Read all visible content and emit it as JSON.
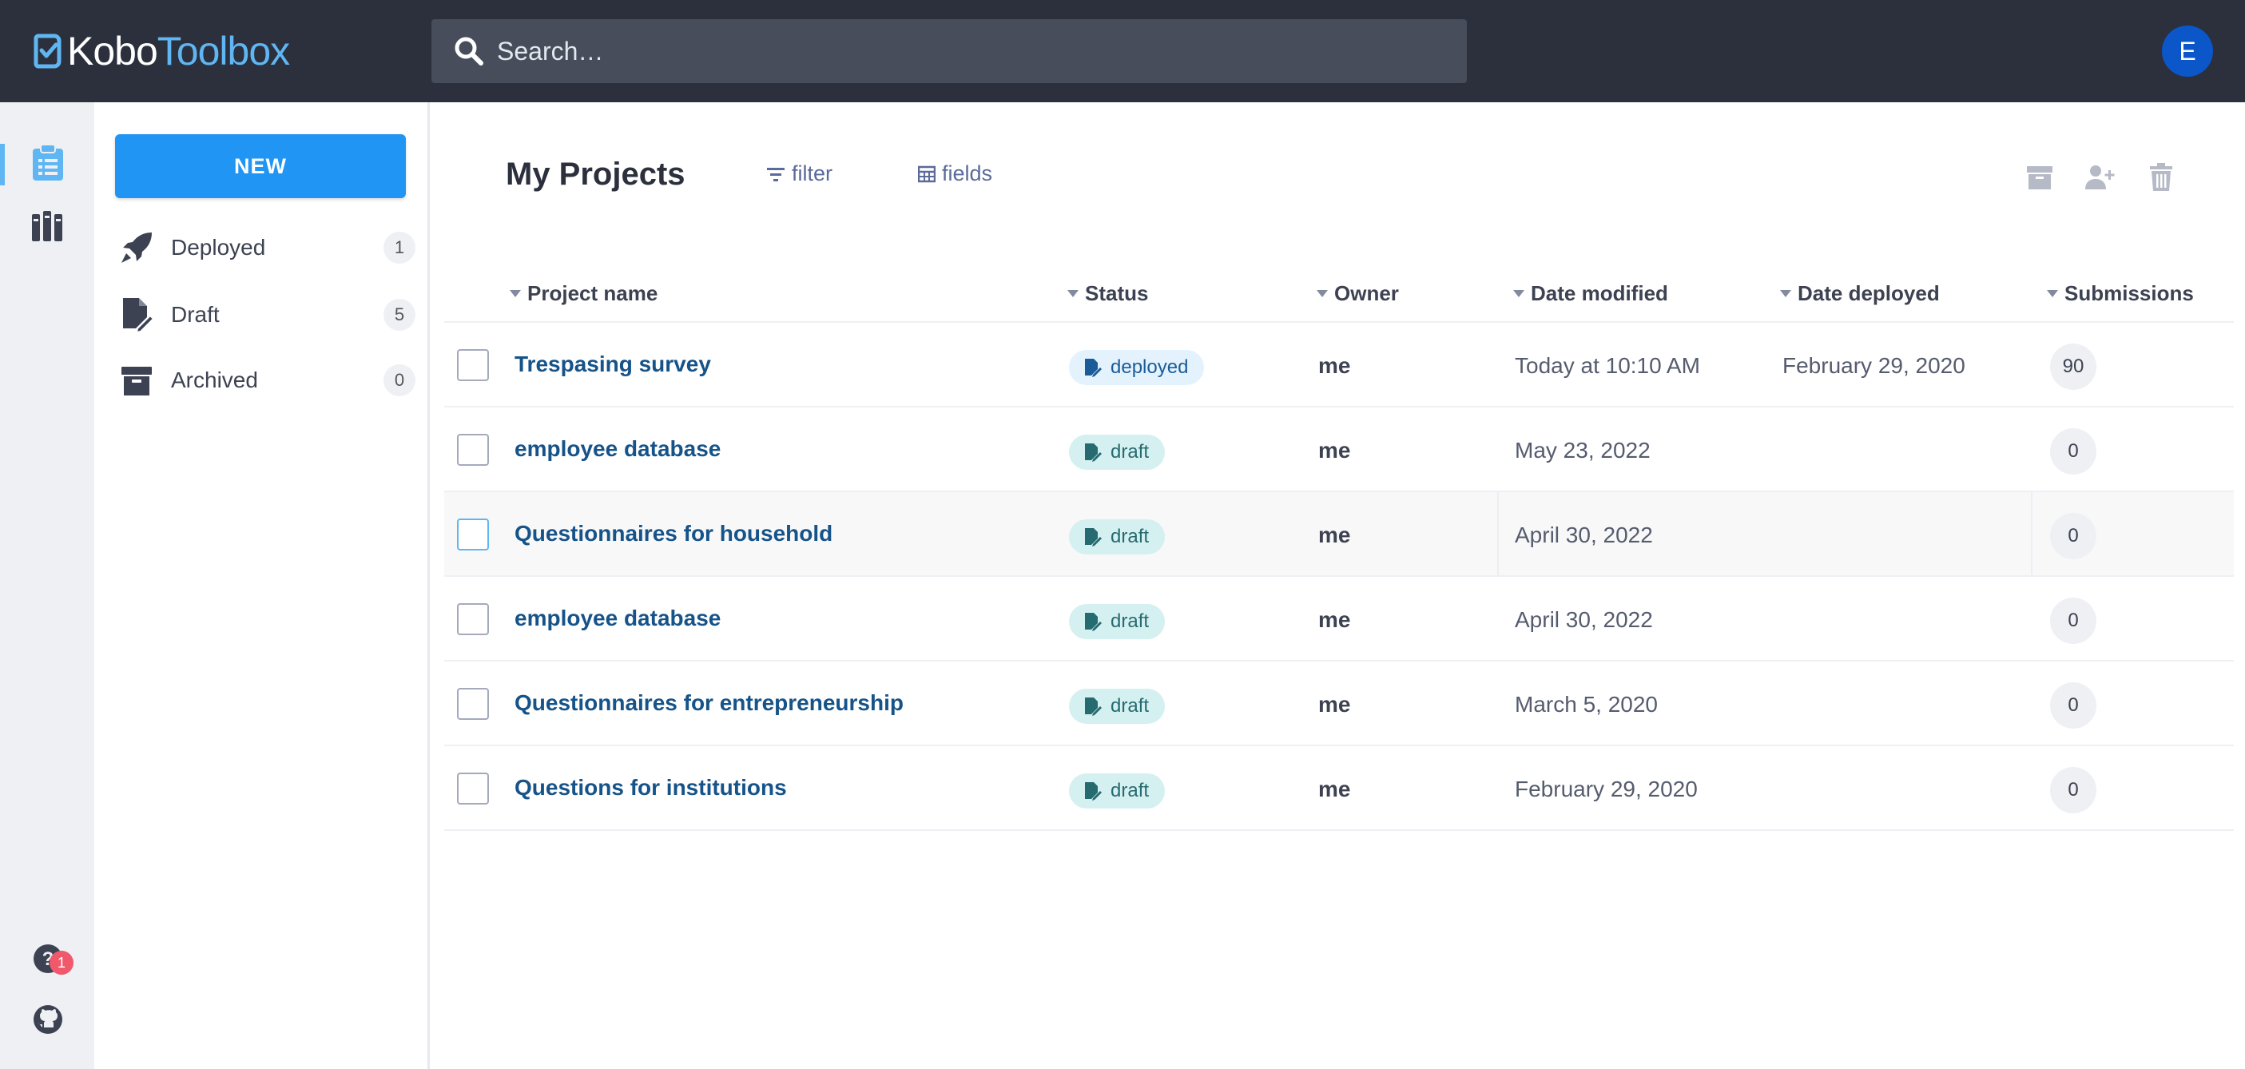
{
  "app": {
    "logo_kobo": "Kobo",
    "logo_toolbox": "Toolbox"
  },
  "search": {
    "placeholder": "Search…"
  },
  "user": {
    "avatar_initial": "E",
    "avatar_color": "#0b56c9"
  },
  "rail": {
    "help_badge_count": "1"
  },
  "sidebar": {
    "new_button": "NEW",
    "items": [
      {
        "label": "Deployed",
        "count": "1",
        "icon": "rocket-icon"
      },
      {
        "label": "Draft",
        "count": "5",
        "icon": "draft-document-icon"
      },
      {
        "label": "Archived",
        "count": "0",
        "icon": "archive-box-icon"
      }
    ]
  },
  "main": {
    "title": "My Projects",
    "filter_label": "filter",
    "fields_label": "fields",
    "columns": [
      "Project name",
      "Status",
      "Owner",
      "Date modified",
      "Date deployed",
      "Submissions"
    ],
    "rows": [
      {
        "name": "Trespasing survey",
        "status": "deployed",
        "owner": "me",
        "date_modified": "Today at 10:10 AM",
        "date_deployed": "February 29, 2020",
        "submissions": "90"
      },
      {
        "name": "employee database",
        "status": "draft",
        "owner": "me",
        "date_modified": "May 23, 2022",
        "date_deployed": "",
        "submissions": "0"
      },
      {
        "name": "Questionnaires for household",
        "status": "draft",
        "owner": "me",
        "date_modified": "April 30, 2022",
        "date_deployed": "",
        "submissions": "0"
      },
      {
        "name": "employee database",
        "status": "draft",
        "owner": "me",
        "date_modified": "April 30, 2022",
        "date_deployed": "",
        "submissions": "0"
      },
      {
        "name": "Questionnaires for entrepreneurship",
        "status": "draft",
        "owner": "me",
        "date_modified": "March 5, 2020",
        "date_deployed": "",
        "submissions": "0"
      },
      {
        "name": "Questions for institutions",
        "status": "draft",
        "owner": "me",
        "date_modified": "February 29, 2020",
        "date_deployed": "",
        "submissions": "0"
      }
    ]
  },
  "colors": {
    "header_bg": "#2b303c",
    "accent_blue": "#2095f3",
    "link_blue": "#165389",
    "draft_bg": "#d5f0f1",
    "deployed_bg": "#e3f2fd"
  }
}
